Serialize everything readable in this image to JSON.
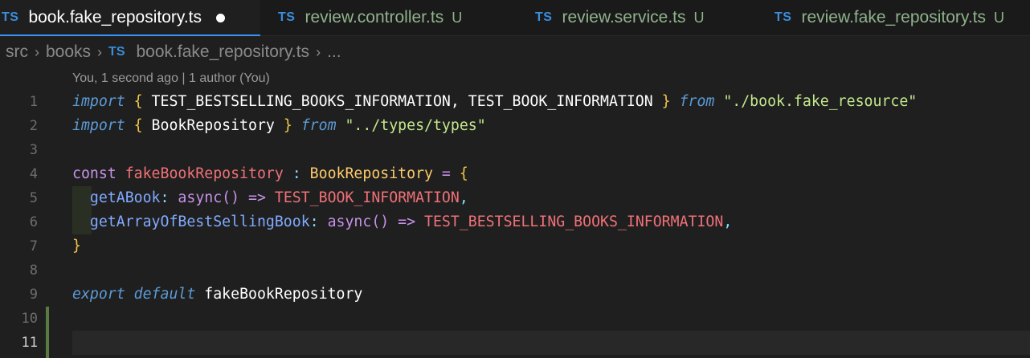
{
  "tabs": [
    {
      "badge": "TS",
      "label": "book.fake_repository.ts",
      "status": "",
      "active": true,
      "modified": true
    },
    {
      "badge": "TS",
      "label": "review.controller.ts",
      "status": "U",
      "active": false
    },
    {
      "badge": "TS",
      "label": "review.service.ts",
      "status": "U",
      "active": false
    },
    {
      "badge": "TS",
      "label": "review.fake_repository.ts",
      "status": "U",
      "active": false
    }
  ],
  "breadcrumb": {
    "items": [
      "src",
      "books"
    ],
    "file_badge": "TS",
    "file": "book.fake_repository.ts",
    "more": "..."
  },
  "blame": "You, 1 second ago | 1 author (You)",
  "line_numbers": [
    "1",
    "2",
    "3",
    "4",
    "5",
    "6",
    "7",
    "8",
    "9",
    "10",
    "11"
  ],
  "code": {
    "l1": {
      "import": "import",
      "ob": "{",
      "names": " TEST_BESTSELLING_BOOKS_INFORMATION, TEST_BOOK_INFORMATION ",
      "cb": "}",
      "from": "from",
      "path": "\"./book.fake_resource\""
    },
    "l2": {
      "import": "import",
      "ob": "{",
      "names": " BookRepository ",
      "cb": "}",
      "from": "from",
      "path": "\"../types/types\""
    },
    "l4": {
      "const": "const",
      "name": "fakeBookRepository",
      "colon": " : ",
      "type": "BookRepository",
      "eq": " = ",
      "ob": "{"
    },
    "l5": {
      "key": "getABook",
      "colon": ": ",
      "async": "async",
      "paren": "()",
      "arrow": " => ",
      "value": "TEST_BOOK_INFORMATION",
      "comma": ","
    },
    "l6": {
      "key": "getArrayOfBestSellingBook",
      "colon": ": ",
      "async": "async",
      "paren": "()",
      "arrow": " => ",
      "value": "TEST_BESTSELLING_BOOKS_INFORMATION",
      "comma": ","
    },
    "l7": {
      "cb": "}"
    },
    "l9": {
      "export": "export",
      "default": "default",
      "name": "fakeBookRepository"
    }
  },
  "colors": {
    "tab_accent": "#3794ff",
    "ts_badge": "#3a8edb",
    "untracked": "#8fb28b"
  }
}
